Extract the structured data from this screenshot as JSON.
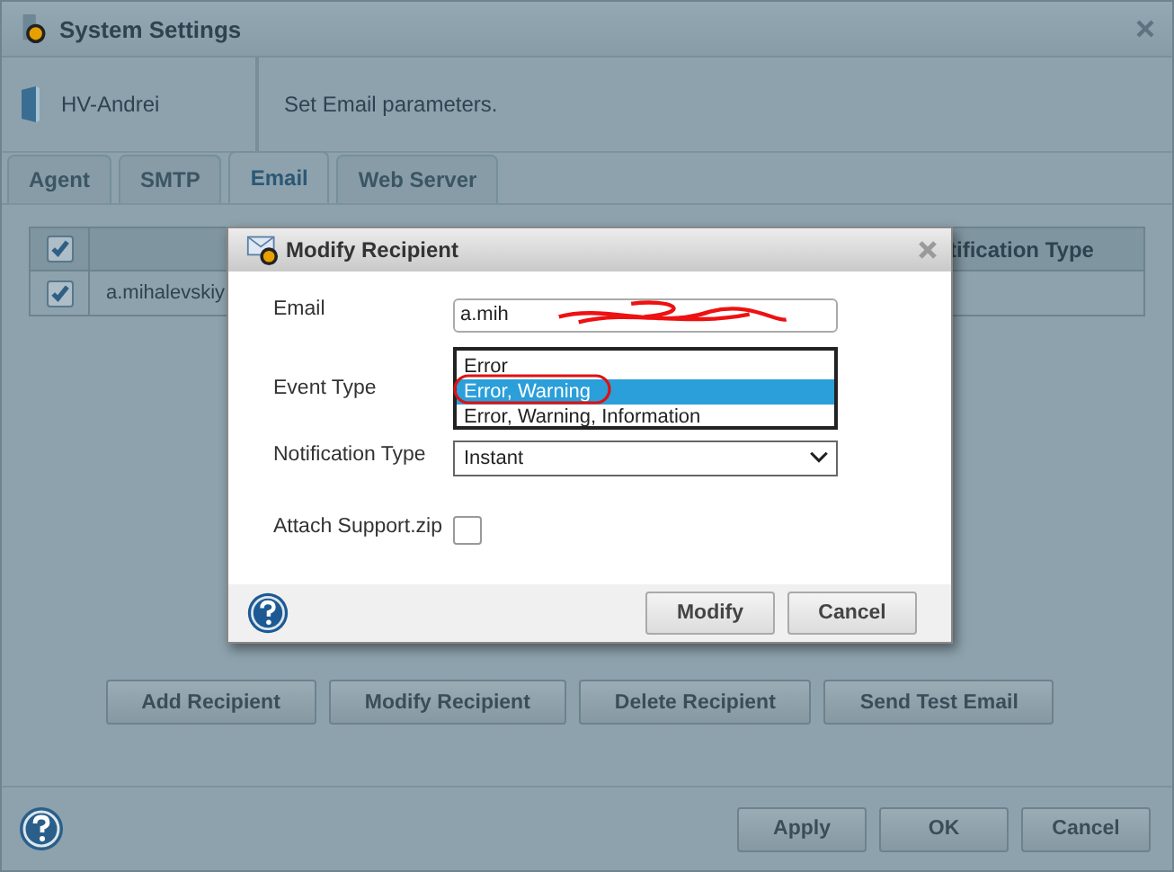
{
  "window": {
    "title": "System Settings"
  },
  "header": {
    "host": "HV-Andrei",
    "description": "Set Email parameters."
  },
  "tabs": [
    {
      "label": "Agent",
      "selected": false
    },
    {
      "label": "SMTP",
      "selected": false
    },
    {
      "label": "Email",
      "selected": true
    },
    {
      "label": "Web Server",
      "selected": false
    }
  ],
  "table": {
    "header_checked": true,
    "columns": [
      "tification Type"
    ],
    "rows": [
      {
        "checked": true,
        "email": "a.mihalevskiy"
      }
    ]
  },
  "actions": [
    "Add Recipient",
    "Modify Recipient",
    "Delete Recipient",
    "Send Test Email"
  ],
  "buttons": [
    "Apply",
    "OK",
    "Cancel"
  ],
  "dialog": {
    "title": "Modify Recipient",
    "email": {
      "label": "Email",
      "value": "a.mih"
    },
    "event_type": {
      "label": "Event Type",
      "options": [
        {
          "label": "Error",
          "selected": false
        },
        {
          "label": "Error, Warning",
          "selected": true
        },
        {
          "label": "Error, Warning, Information",
          "selected": false
        }
      ]
    },
    "notification_type": {
      "label": "Notification Type",
      "value": "Instant"
    },
    "attach": {
      "label": "Attach Support.zip",
      "checked": false
    },
    "buttons": [
      "Modify",
      "Cancel"
    ]
  }
}
